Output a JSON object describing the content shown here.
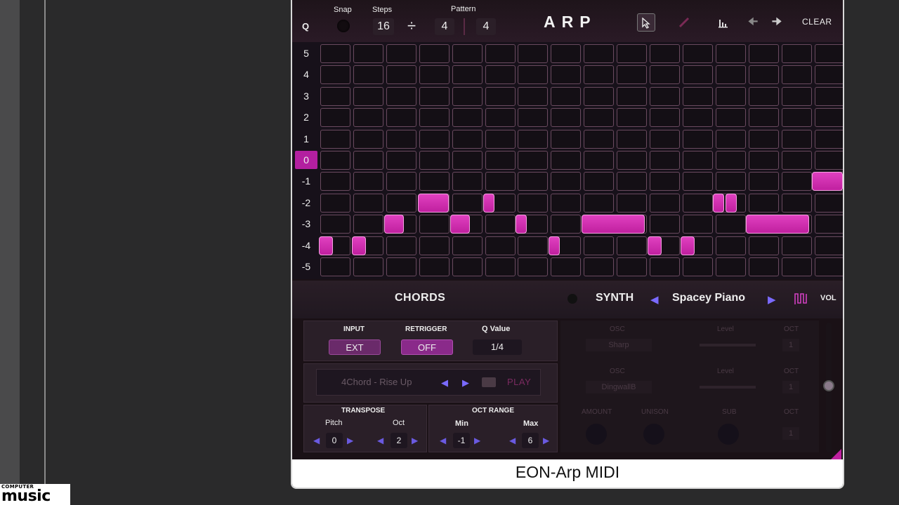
{
  "brand_logo": {
    "line1": "COMPUTER",
    "line2": "music"
  },
  "topbar": {
    "q_label": "Q",
    "snap_label": "Snap",
    "steps_label": "Steps",
    "steps_value": "16",
    "divide_symbol": "÷",
    "steps_div_value": "4",
    "pattern_label": "Pattern",
    "pattern_value": "4",
    "title": "ARP",
    "clear_label": "CLEAR"
  },
  "row_labels": [
    "5",
    "4",
    "3",
    "2",
    "1",
    "0",
    "-1",
    "-2",
    "-3",
    "-4",
    "-5"
  ],
  "selected_row": "0",
  "chords_label": "CHORDS",
  "synth": {
    "label": "SYNTH",
    "preset": "Spacey Piano",
    "vol_label": "VOL"
  },
  "controls": {
    "input_label": "INPUT",
    "input_value": "EXT",
    "retrigger_label": "RETRIGGER",
    "retrigger_value": "OFF",
    "q_value_label": "Q Value",
    "q_value": "1/4",
    "chord_preset": "4Chord - Rise Up",
    "play_label": "PLAY",
    "transpose_label": "TRANSPOSE",
    "pitch_label": "Pitch",
    "pitch_value": "0",
    "oct_label": "Oct",
    "oct_value": "2",
    "oct_range_label": "OCT RANGE",
    "min_label": "Min",
    "min_value": "-1",
    "max_label": "Max",
    "max_value": "6"
  },
  "osc": {
    "osc_label": "OSC",
    "level_label": "Level",
    "oct_label": "OCT",
    "osc1_wave": "Sharp",
    "osc1_oct": "1",
    "osc2_wave": "DingwallB",
    "osc2_oct": "1",
    "amount_label": "AMOUNT",
    "unison_label": "UNISON",
    "sub_label": "SUB",
    "sub_oct": "1"
  },
  "caption": "EON-Arp MIDI",
  "colors": {
    "accent": "#c0209f",
    "arrow": "#7a6aff",
    "panel": "#2a1f28"
  }
}
